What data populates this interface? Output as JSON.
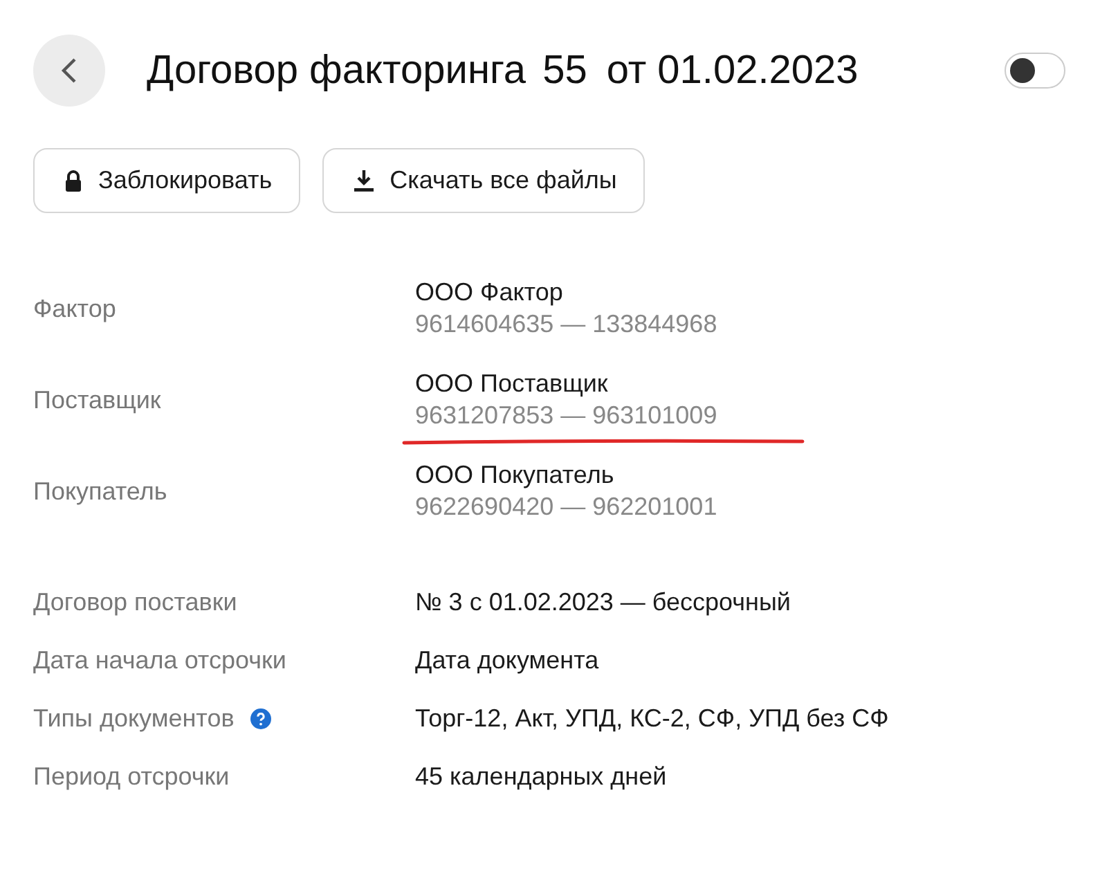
{
  "header": {
    "title": "Договор факторинга",
    "number": "55",
    "date": "от 01.02.2023",
    "toggle": {
      "on": false
    }
  },
  "actions": [
    {
      "kind": "lock",
      "label": "Заблокировать"
    },
    {
      "kind": "download",
      "label": "Скачать все файлы"
    }
  ],
  "parties": [
    {
      "label": "Фактор",
      "name": "ООО Фактор",
      "ids": "9614604635 — 133844968",
      "underlined": false
    },
    {
      "label": "Поставщик",
      "name": "ООО Поставщик",
      "ids": "9631207853 — 963101009",
      "underlined": true
    },
    {
      "label": "Покупатель",
      "name": "ООО Покупатель",
      "ids": "9622690420 — 962201001",
      "underlined": false
    }
  ],
  "details": [
    {
      "label": "Договор поставки",
      "value": "№ 3 с 01.02.2023 — бессрочный",
      "help": false
    },
    {
      "label": "Дата начала отсрочки",
      "value": "Дата документа",
      "help": false
    },
    {
      "label": "Типы документов",
      "value": "Торг-12, Акт, УПД, КС-2, СФ, УПД без СФ",
      "help": true
    },
    {
      "label": "Период отсрочки",
      "value": "45 календарных дней",
      "help": false
    }
  ]
}
